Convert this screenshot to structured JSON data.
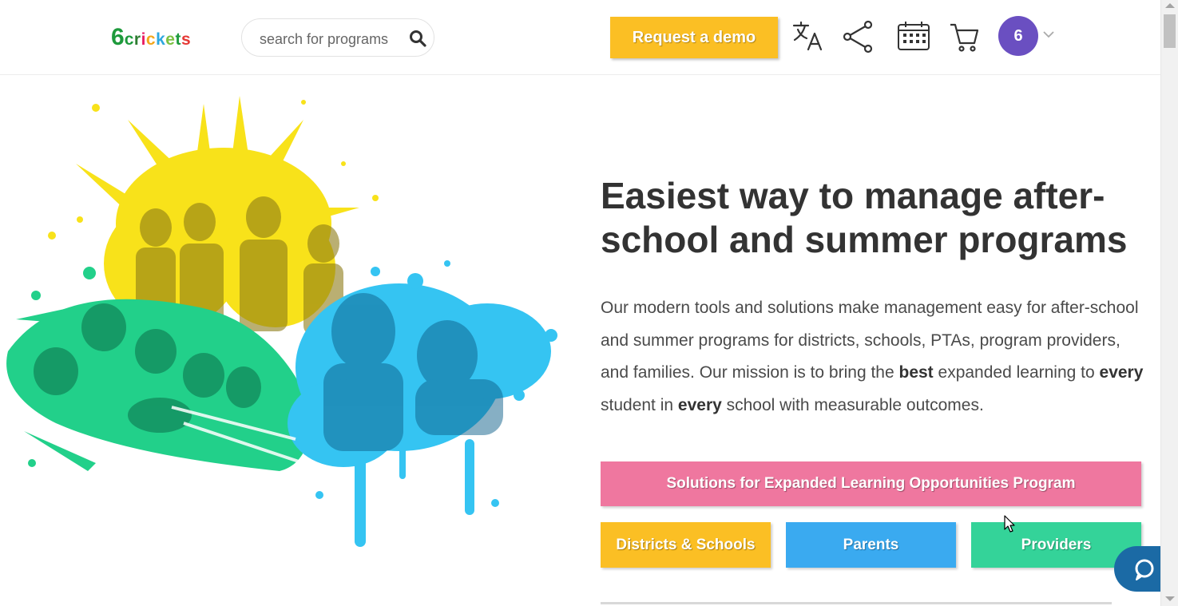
{
  "header": {
    "logo": {
      "six": "6",
      "word_letters": [
        "c",
        "r",
        "i",
        "c",
        "k",
        "e",
        "t",
        "s"
      ]
    },
    "search": {
      "placeholder": "search for programs"
    },
    "demo_label": "Request a demo",
    "icons": [
      "translate-icon",
      "share-icon",
      "calendar-icon",
      "cart-icon"
    ],
    "avatar_label": "6"
  },
  "hero": {
    "title": "Easiest way to manage after-school and summer programs",
    "description": {
      "part1": "Our modern tools and solutions make management easy for after-school and summer programs for districts, schools, PTAs, program providers, and families. Our mission is to bring the ",
      "best": "best",
      "part2": " expanded learning to ",
      "every1": "every",
      "part3": " student in ",
      "every2": "every",
      "part4": " school with measurable outcomes."
    }
  },
  "buttons": {
    "elo": "Solutions for Expanded Learning Opportunities Program",
    "districts": "Districts & Schools",
    "parents": "Parents",
    "providers": "Providers"
  },
  "colors": {
    "demo": "#fbbf24",
    "elo": "#ef779f",
    "districts": "#fbbf24",
    "parents": "#3aaaf0",
    "providers": "#34d399",
    "avatar": "#6a4fc1",
    "chat": "#1b6aa5"
  }
}
